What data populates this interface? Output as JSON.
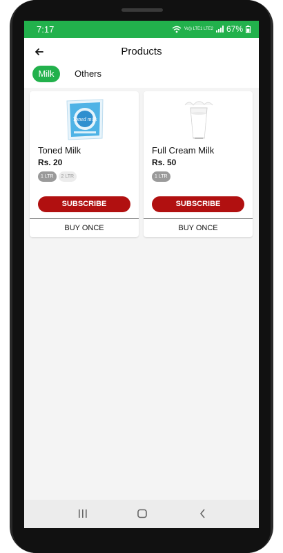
{
  "status": {
    "time": "7:17",
    "network_label": "Vo)) LTE1 LTE2",
    "battery": "67%"
  },
  "header": {
    "title": "Products"
  },
  "tabs": [
    {
      "label": "Milk",
      "active": true
    },
    {
      "label": "Others",
      "active": false
    }
  ],
  "products": [
    {
      "name": "Toned Milk",
      "price": "Rs. 20",
      "image_icon": "milk-pouch-icon",
      "image_text": "Toned milk",
      "variants": [
        {
          "label": "1 LTR",
          "selected": true
        },
        {
          "label": "2 LTR",
          "selected": false
        }
      ],
      "subscribe_label": "SUBSCRIBE",
      "buy_once_label": "BUY ONCE"
    },
    {
      "name": "Full Cream Milk",
      "price": "Rs. 50",
      "image_icon": "milk-glass-icon",
      "variants": [
        {
          "label": "1 LTR",
          "selected": true
        }
      ],
      "subscribe_label": "SUBSCRIBE",
      "buy_once_label": "BUY ONCE"
    }
  ],
  "colors": {
    "primary_green": "#22b14c",
    "subscribe_red": "#b11010"
  }
}
